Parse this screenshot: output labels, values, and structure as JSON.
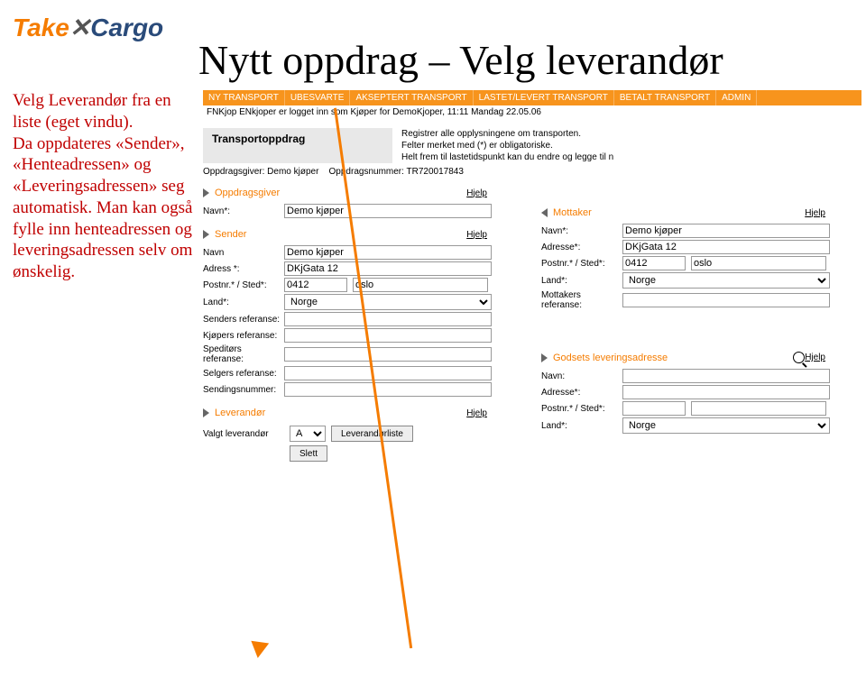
{
  "logo": {
    "part1": "Take",
    "part2": "✕",
    "part3": "Cargo"
  },
  "title": "Nytt oppdrag – Velg leverandør",
  "sidetext": "Velg Leverandør fra en liste (eget vindu).\nDa oppdateres «Sender», «Henteadressen» og «Leveringsadressen» seg automatisk. Man kan også fylle inn henteadressen og leveringsadressen selv om ønskelig.",
  "tabs": [
    "NY TRANSPORT",
    "UBESVARTE",
    "AKSEPTERT TRANSPORT",
    "LASTET/LEVERT TRANSPORT",
    "BETALT TRANSPORT",
    "ADMIN"
  ],
  "login_line": "FNKjop ENkjoper er logget inn som Kjøper for DemoKjoper, 11:11 Mandag 22.05.06",
  "section_title": "Transportoppdrag",
  "instructions": [
    "Registrer alle opplysningene om transporten.",
    "Felter merket med (*) er obligatoriske.",
    "Helt frem til lastetidspunkt kan du endre og legge til n"
  ],
  "orderinfo": {
    "giver_label": "Oppdragsgiver:",
    "giver_value": "Demo kjøper",
    "num_label": "Oppdragsnummer:",
    "num_value": "TR720017843"
  },
  "hjelp": "Hjelp",
  "groups": {
    "oppdragsgiver": "Oppdragsgiver",
    "sender": "Sender",
    "mottaker": "Mottaker",
    "godsets": "Godsets leveringsadresse",
    "leverandor": "Leverandør"
  },
  "labels": {
    "navn": "Navn*:",
    "navn_plain": "Navn:",
    "adresse": "Adresse*:",
    "postnr": "Postnr.* / Sted*:",
    "land": "Land*:",
    "senders_ref": "Senders referanse:",
    "kjopers_ref": "Kjøpers referanse:",
    "speditor_ref": "Speditørs referanse:",
    "selgers_ref": "Selgers referanse:",
    "sendingsnummer": "Sendingsnummer:",
    "mottakers_ref": "Mottakers referanse:",
    "valgt_lev": "Valgt leverandør",
    "lev_liste": "Leverandørliste",
    "slett": "Slett"
  },
  "values": {
    "navn": "Demo kjøper",
    "adresse": "DKjGata 12",
    "postnr": "0412",
    "sted": "oslo",
    "land": "Norge",
    "lev_sel": "A"
  }
}
